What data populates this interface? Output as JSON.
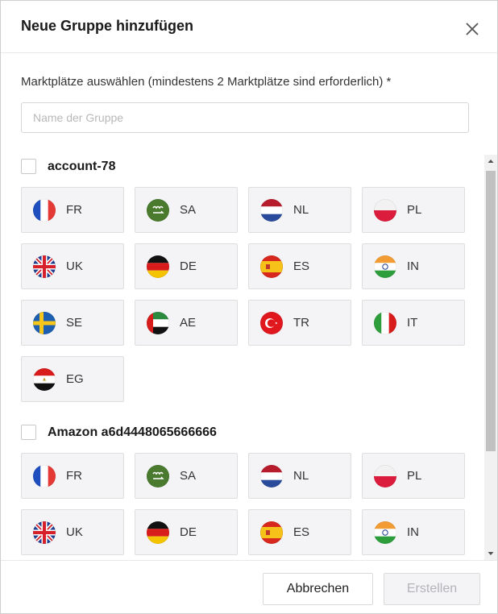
{
  "dialog": {
    "title": "Neue Gruppe hinzufügen",
    "close_icon": "close-icon"
  },
  "form": {
    "instruction": "Marktplätze auswählen (mindestens 2 Marktplätze sind erforderlich) *",
    "name_placeholder": "Name der Gruppe",
    "name_value": ""
  },
  "accounts": [
    {
      "name": "account-78",
      "checked": false,
      "marketplaces": [
        "FR",
        "SA",
        "NL",
        "PL",
        "UK",
        "DE",
        "ES",
        "IN",
        "SE",
        "AE",
        "TR",
        "IT",
        "EG"
      ]
    },
    {
      "name": "Amazon a6d4448065666666",
      "checked": false,
      "marketplaces": [
        "FR",
        "SA",
        "NL",
        "PL",
        "UK",
        "DE",
        "ES",
        "IN"
      ]
    }
  ],
  "footer": {
    "cancel_label": "Abbrechen",
    "create_label": "Erstellen",
    "create_disabled": true
  },
  "colors": {
    "tile_bg": "#f4f4f6",
    "disabled_text": "#b4b4b8",
    "scroll_thumb": "#c1c1c1"
  }
}
